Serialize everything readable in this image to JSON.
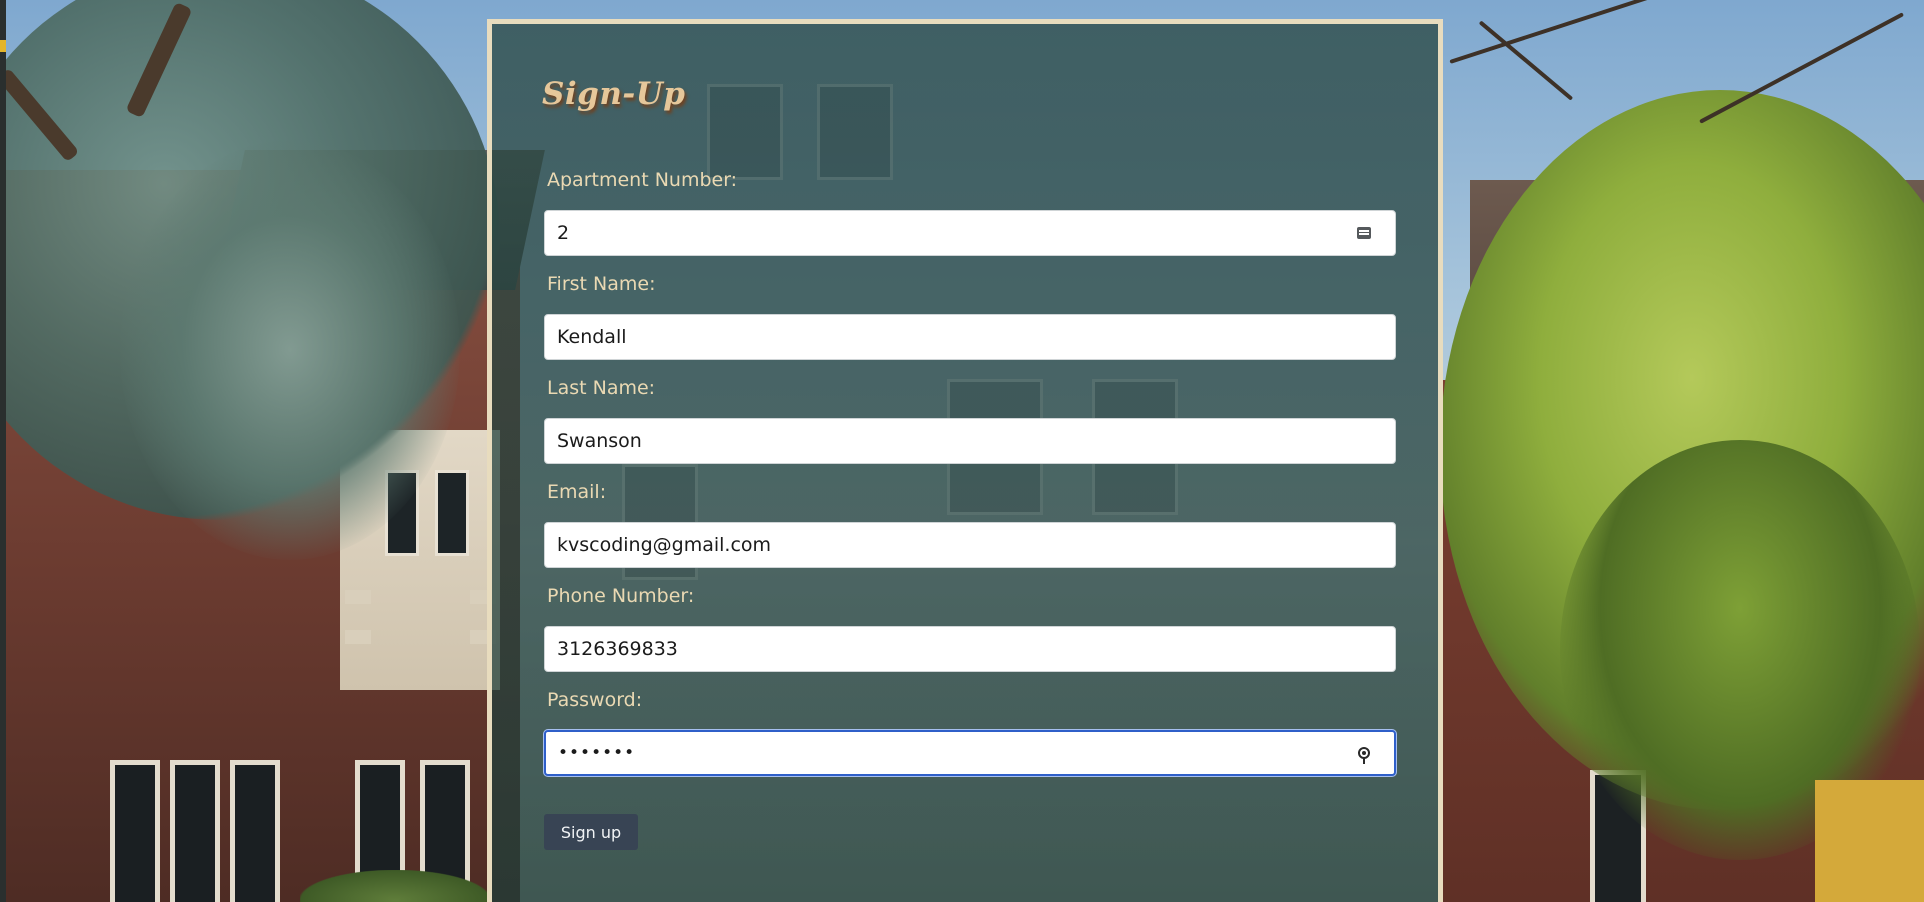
{
  "form": {
    "title": "Sign-Up",
    "fields": [
      {
        "label": "Apartment Number:",
        "value": "2",
        "type": "number"
      },
      {
        "label": "First Name:",
        "value": "Kendall",
        "type": "text"
      },
      {
        "label": "Last Name:",
        "value": "Swanson",
        "type": "text"
      },
      {
        "label": "Email:",
        "value": "kvscoding@gmail.com",
        "type": "email"
      },
      {
        "label": "Phone Number:",
        "value": "3126369833",
        "type": "tel"
      },
      {
        "label": "Password:",
        "value": "•••••••",
        "type": "password",
        "focused": true
      }
    ],
    "submit_label": "Sign up"
  },
  "icons": {
    "number_field": "spinner-icon",
    "password_field": "password-key-icon"
  },
  "colors": {
    "panel_border": "#e8dcbe",
    "title": "#e6c79a",
    "label": "#ead9b3",
    "focus": "#2f5fc9",
    "button": "#384454"
  }
}
